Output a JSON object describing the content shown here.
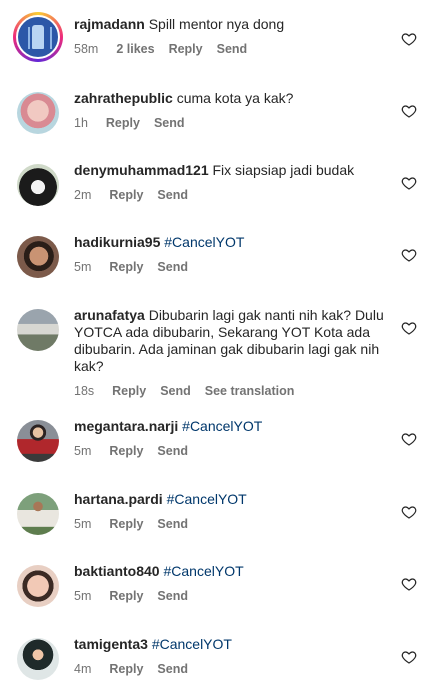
{
  "comments": [
    {
      "user": "rajmadann",
      "text": "Spill mentor nya dong",
      "tag": "",
      "time": "58m",
      "likes": "2 likes",
      "reply": "Reply",
      "send": "Send",
      "extra": "",
      "avatar": "story-ring"
    },
    {
      "user": "zahrathepublic",
      "text": "cuma kota ya kak?",
      "tag": "",
      "time": "1h",
      "likes": "",
      "reply": "Reply",
      "send": "Send",
      "extra": "",
      "avatar": "pink-face"
    },
    {
      "user": "denymuhammad121",
      "text": "Fix siapsiap jadi budak",
      "tag": "",
      "time": "2m",
      "likes": "",
      "reply": "Reply",
      "send": "Send",
      "extra": "",
      "avatar": "dark-hair"
    },
    {
      "user": "hadikurnia95",
      "text": "",
      "tag": "#CancelYOT",
      "time": "5m",
      "likes": "",
      "reply": "Reply",
      "send": "Send",
      "extra": "",
      "avatar": "selfie"
    },
    {
      "user": "arunafatya",
      "text": "Dibubarin lagi gak nanti nih kak? Dulu YOTCA ada dibubarin, Sekarang YOT Kota ada dibubarin. Ada jaminan gak dibubarin lagi gak nih kak?",
      "tag": "",
      "time": "18s",
      "likes": "",
      "reply": "Reply",
      "send": "Send",
      "extra": "See translation",
      "avatar": "building"
    },
    {
      "user": "megantara.narji",
      "text": "",
      "tag": "#CancelYOT",
      "time": "5m",
      "likes": "",
      "reply": "Reply",
      "send": "Send",
      "extra": "",
      "avatar": "red-jacket"
    },
    {
      "user": "hartana.pardi",
      "text": "",
      "tag": "#CancelYOT",
      "time": "5m",
      "likes": "",
      "reply": "Reply",
      "send": "Send",
      "extra": "",
      "avatar": "outdoor"
    },
    {
      "user": "baktianto840",
      "text": "",
      "tag": "#CancelYOT",
      "time": "5m",
      "likes": "",
      "reply": "Reply",
      "send": "Send",
      "extra": "",
      "avatar": "closeup"
    },
    {
      "user": "tamigenta3",
      "text": "",
      "tag": "#CancelYOT",
      "time": "4m",
      "likes": "",
      "reply": "Reply",
      "send": "Send",
      "extra": "",
      "avatar": "hijab"
    }
  ],
  "icons": {
    "like": "heart-outline-icon"
  }
}
